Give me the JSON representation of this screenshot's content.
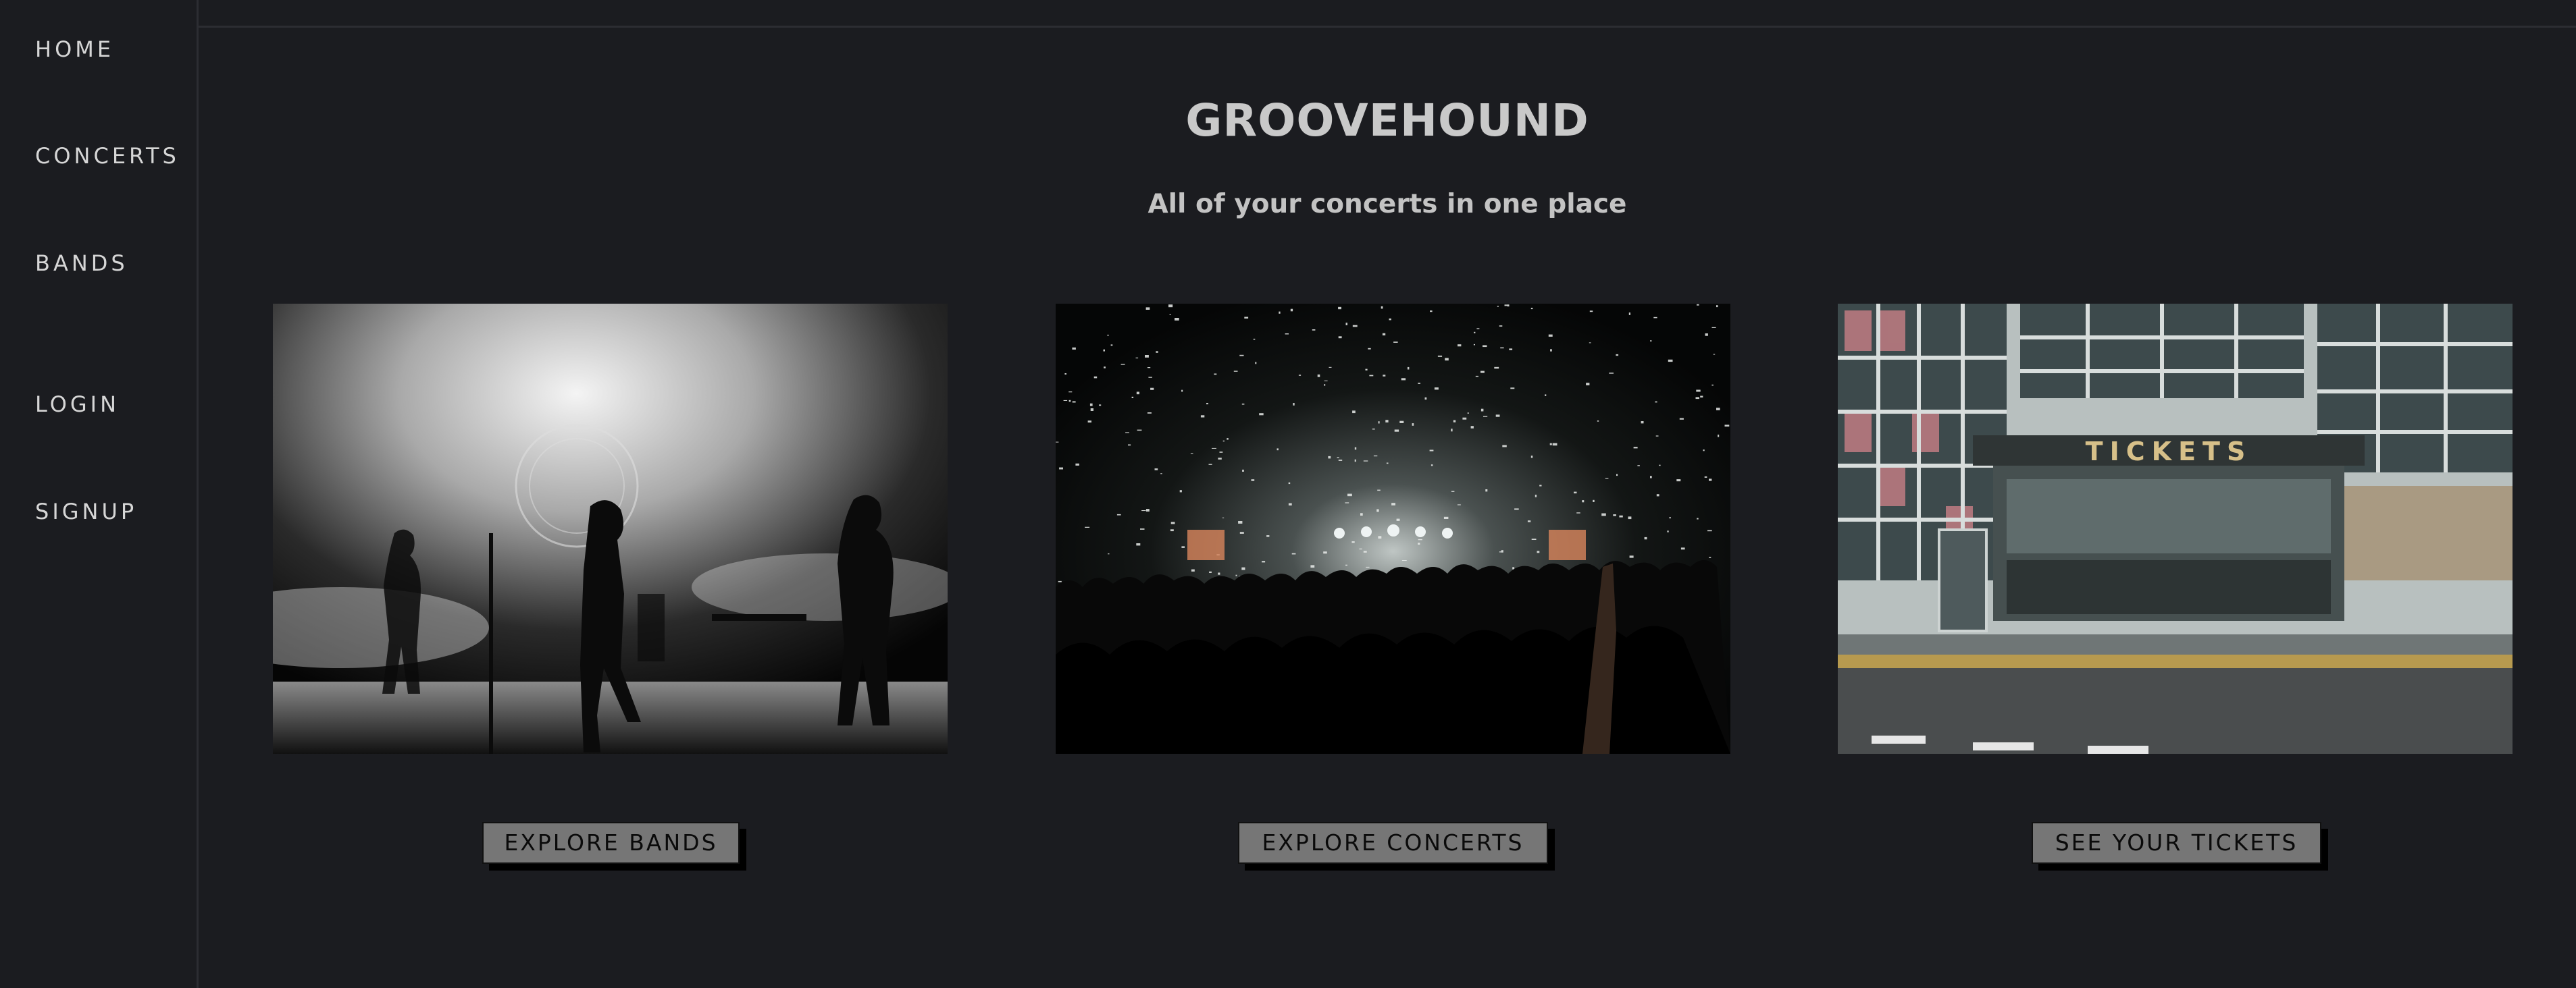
{
  "sidebar": {
    "items": [
      {
        "label": "HOME"
      },
      {
        "label": "CONCERTS"
      },
      {
        "label": "BANDS"
      },
      {
        "label": "LOGIN"
      },
      {
        "label": "SIGNUP"
      }
    ]
  },
  "header": {
    "title": "GROOVEHOUND",
    "subtitle": "All of your concerts in one place"
  },
  "cards": [
    {
      "image": "band-on-stage-photo",
      "button": "EXPLORE BANDS"
    },
    {
      "image": "concert-crowd-confetti-photo",
      "button": "EXPLORE CONCERTS"
    },
    {
      "image": "ticket-office-building-photo",
      "sign": "TICKETS",
      "button": "SEE YOUR TICKETS"
    }
  ],
  "colors": {
    "background": "#1b1c20",
    "nav_text": "#d6d6d6",
    "button_bg": "#767676"
  }
}
